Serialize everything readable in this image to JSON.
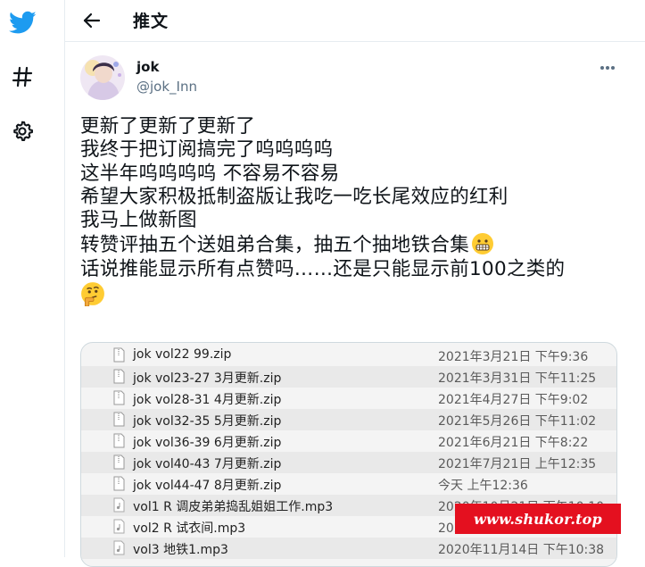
{
  "header": {
    "title": "推文"
  },
  "author": {
    "name": "jok",
    "handle": "@jok_Inn"
  },
  "tweet": {
    "lines": [
      "更新了更新了更新了",
      "我终于把订阅搞完了呜呜呜呜",
      "这半年呜呜呜呜  不容易不容易",
      "希望大家积极抵制盗版让我吃一吃长尾效应的红利",
      "我马上做新图",
      "转赞评抽五个送姐弟合集，抽五个抽地铁合集",
      "话说推能显示所有点赞吗……还是只能显示前100之类的"
    ]
  },
  "files": [
    {
      "name": "jok vol22 99.zip",
      "date": "2021年3月21日 下午9:36",
      "icon": "zip-file-icon"
    },
    {
      "name": "jok vol23-27 3月更新.zip",
      "date": "2021年3月31日 下午11:25",
      "icon": "zip-file-icon"
    },
    {
      "name": "jok vol28-31 4月更新.zip",
      "date": "2021年4月27日 下午9:02",
      "icon": "zip-file-icon"
    },
    {
      "name": "jok vol32-35 5月更新.zip",
      "date": "2021年5月26日 下午11:02",
      "icon": "zip-file-icon"
    },
    {
      "name": "jok vol36-39 6月更新.zip",
      "date": "2021年6月21日 下午8:22",
      "icon": "zip-file-icon"
    },
    {
      "name": "jok vol40-43 7月更新.zip",
      "date": "2021年7月21日 上午12:35",
      "icon": "zip-file-icon"
    },
    {
      "name": "jok vol44-47 8月更新.zip",
      "date": "今天 上午12:36",
      "icon": "zip-file-icon"
    },
    {
      "name": "vol1 R 调皮弟弟捣乱姐姐工作.mp3",
      "date": "2020年10月21日 下午10:10",
      "icon": "audio-file-icon"
    },
    {
      "name": "vol2 R 试衣间.mp3",
      "date": "2020年11月8日 下午9:27",
      "icon": "audio-file-icon"
    },
    {
      "name": "vol3 地铁1.mp3",
      "date": "2020年11月14日 下午10:38",
      "icon": "audio-file-icon"
    }
  ],
  "watermark": {
    "text": "www.shukor.top"
  },
  "colors": {
    "twitter_blue": "#1d9bf0",
    "watermark_red": "#e4101f"
  }
}
